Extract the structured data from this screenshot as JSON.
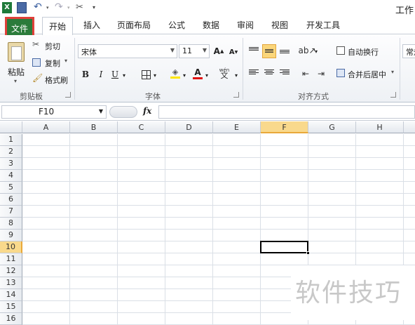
{
  "window": {
    "title": "工作"
  },
  "qat": {
    "icons": [
      "excel-logo-icon",
      "save-icon",
      "undo-icon",
      "redo-icon",
      "customize-icon"
    ]
  },
  "tabs": [
    {
      "label": "文件"
    },
    {
      "label": "开始"
    },
    {
      "label": "插入"
    },
    {
      "label": "页面布局"
    },
    {
      "label": "公式"
    },
    {
      "label": "数据"
    },
    {
      "label": "审阅"
    },
    {
      "label": "视图"
    },
    {
      "label": "开发工具"
    }
  ],
  "ribbon": {
    "clipboard": {
      "paste": "粘贴",
      "cut": "剪切",
      "copy": "复制",
      "format_painter": "格式刷",
      "label": "剪贴板"
    },
    "font": {
      "name": "宋体",
      "size": "11",
      "bold": "B",
      "italic": "I",
      "underline": "U",
      "grow": "A",
      "shrink": "A",
      "label": "字体",
      "wen": "wén"
    },
    "alignment": {
      "wrap": "自动换行",
      "merge": "合并后居中",
      "label": "对齐方式"
    },
    "number": {
      "format": "常规"
    }
  },
  "formula_bar": {
    "name_box": "F10",
    "fx": "fx",
    "formula": ""
  },
  "grid": {
    "columns": [
      "A",
      "B",
      "C",
      "D",
      "E",
      "F",
      "G",
      "H"
    ],
    "rows": [
      "1",
      "2",
      "3",
      "4",
      "5",
      "6",
      "7",
      "8",
      "9",
      "10",
      "11",
      "12",
      "13",
      "14",
      "15",
      "16"
    ],
    "selected_column": "F",
    "selected_row": "10"
  },
  "watermark": "软件技巧"
}
